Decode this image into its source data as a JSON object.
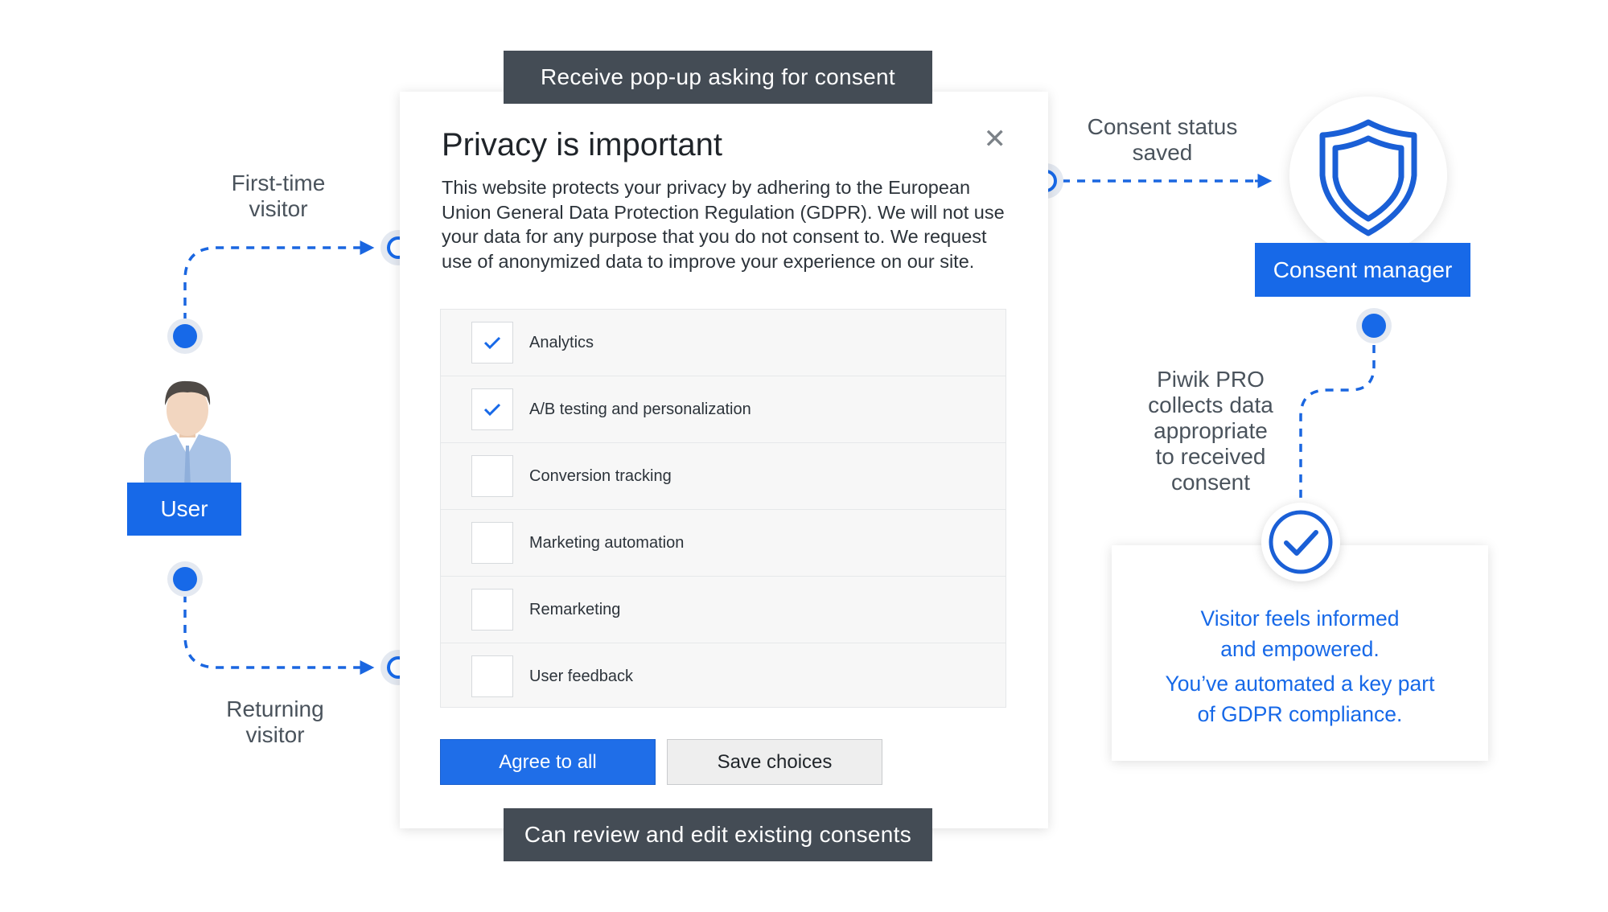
{
  "banners": {
    "top": "Receive pop-up asking for consent",
    "bottom": "Can review and edit existing consents"
  },
  "left": {
    "first_time": "First-time\nvisitor",
    "returning": "Returning\nvisitor",
    "user_label": "User"
  },
  "dialog": {
    "title": "Privacy is important",
    "close_glyph": "✕",
    "body": "This website protects your privacy by adhering to the European Union General Data Protection Regulation (GDPR). We will not use your data for any purpose that you do not consent to. We request use of anonymized data to improve your experience on our site.",
    "options": [
      {
        "label": "Analytics",
        "checked": true
      },
      {
        "label": "A/B testing and personalization",
        "checked": true
      },
      {
        "label": "Conversion tracking",
        "checked": false
      },
      {
        "label": "Marketing automation",
        "checked": false
      },
      {
        "label": "Remarketing",
        "checked": false
      },
      {
        "label": "User feedback",
        "checked": false
      }
    ],
    "agree_button": "Agree to all",
    "save_button": "Save choices"
  },
  "right": {
    "consent_status": "Consent status\nsaved",
    "consent_manager": "Consent manager",
    "collects": "Piwik PRO\ncollects data\nappropriate\nto received\nconsent",
    "result_lines": [
      "Visitor feels informed",
      "and empowered.",
      "You’ve automated a key part",
      "of GDPR compliance."
    ]
  },
  "colors": {
    "accent_blue": "#1769e8",
    "dark_banner": "#444c55",
    "connector": "#1a66e0"
  },
  "icons": [
    "user-avatar-icon",
    "shield-icon",
    "checkmark-circle-icon",
    "close-icon",
    "checkbox-check-icon"
  ]
}
